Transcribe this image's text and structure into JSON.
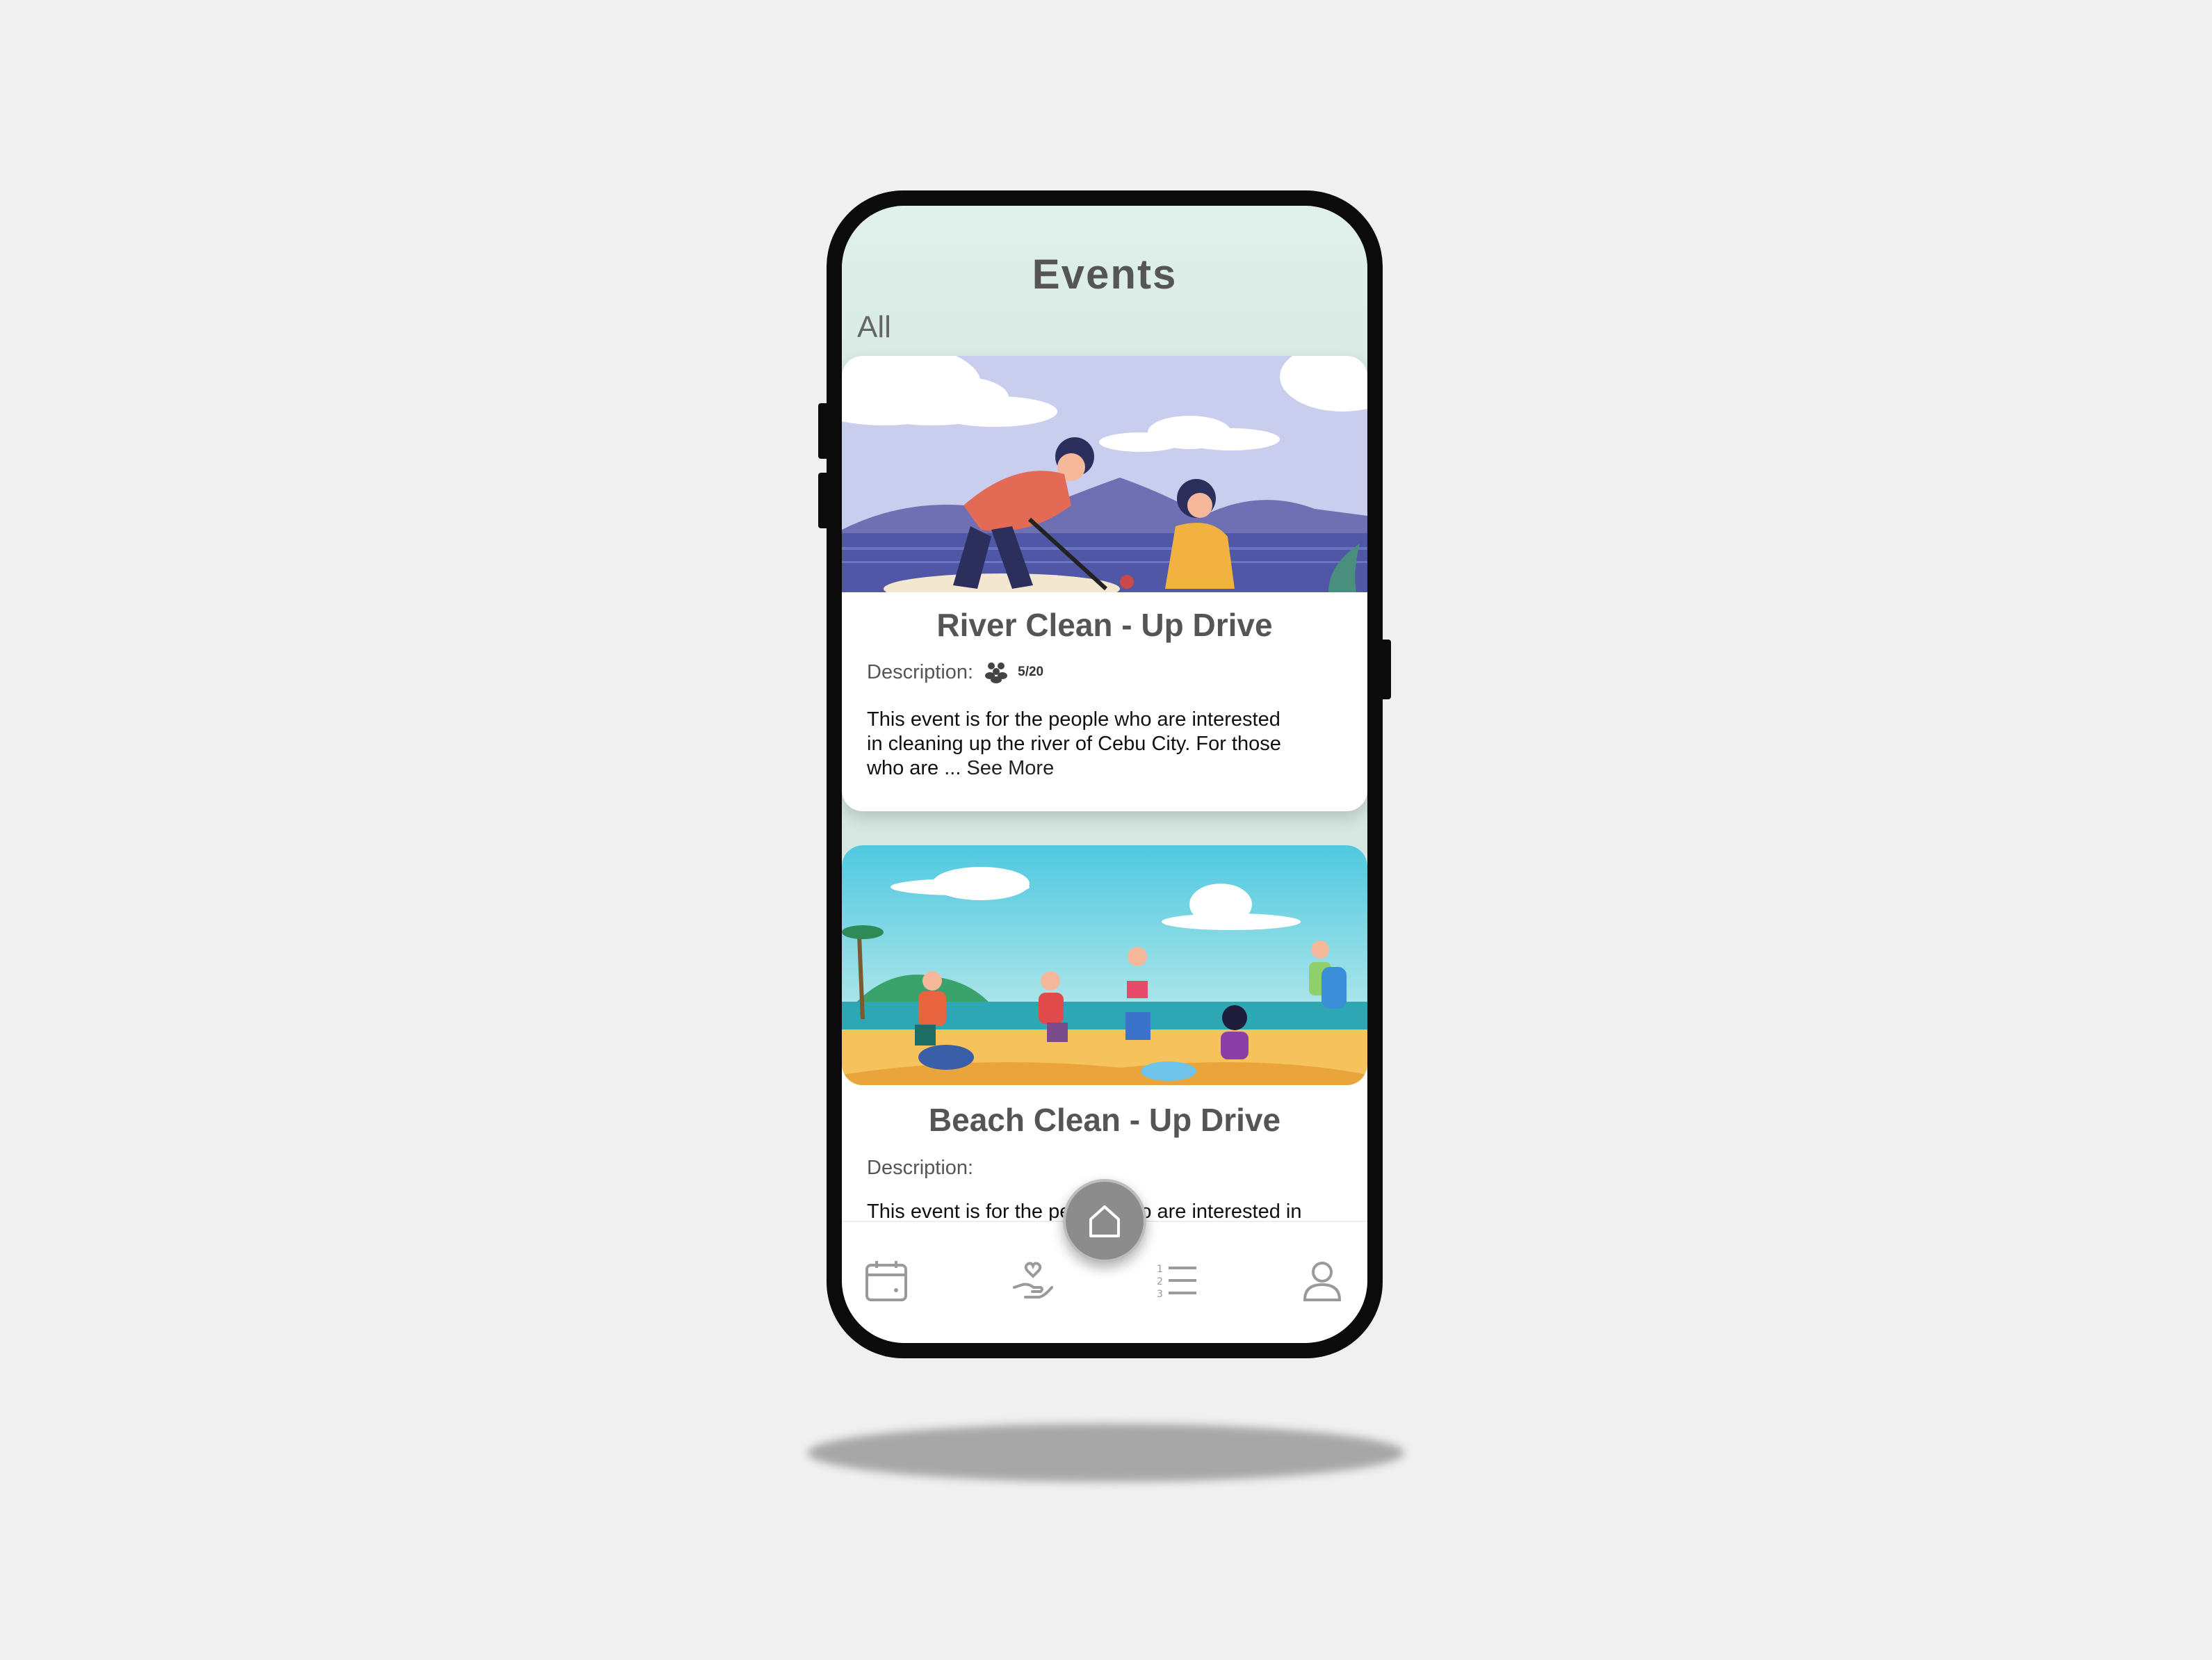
{
  "app": {
    "title": "Events",
    "filter_tab": "All"
  },
  "events": [
    {
      "title": "River Clean - Up Drive",
      "description_label": "Description:",
      "participants": "5/20",
      "description": "This event is for the people who are interested in cleaning up the river of Cebu City. For those who are ...",
      "see_more": "See More"
    },
    {
      "title": "Beach Clean - Up Drive",
      "description_label": "Description:",
      "description": "This event is for the people who are interested in"
    }
  ],
  "bottom_nav": {
    "items": [
      "calendar-icon",
      "volunteer-hand-heart-icon",
      "numbered-list-icon",
      "profile-icon"
    ],
    "center_button": "home-icon"
  },
  "colors": {
    "header_bg": "#dff1ea",
    "fab_bg": "#8c8c8c",
    "text_dark": "#555555"
  }
}
